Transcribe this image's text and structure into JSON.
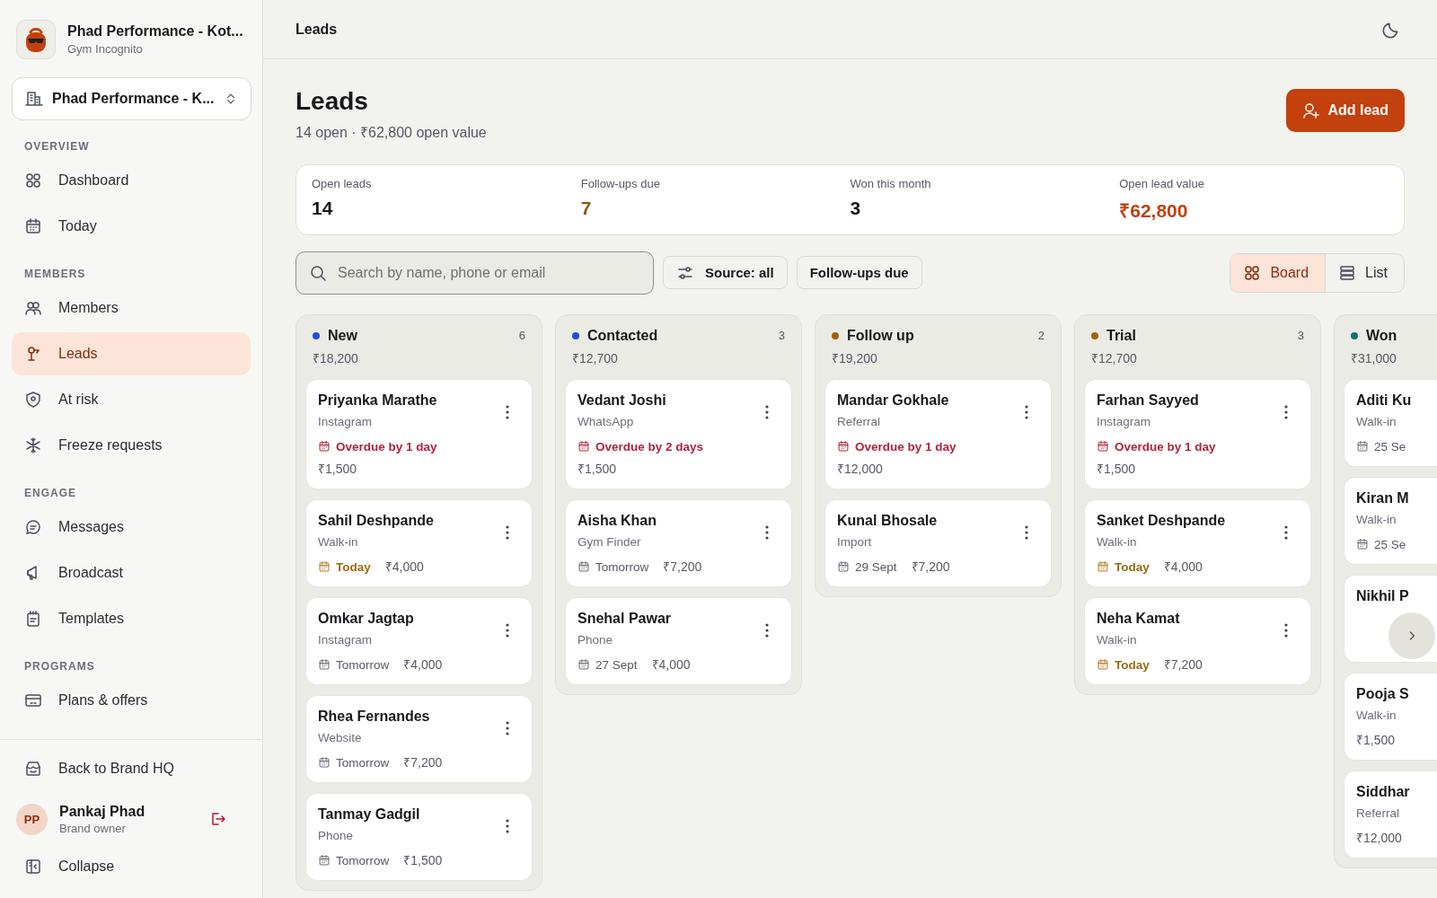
{
  "sidebar": {
    "brand": {
      "name": "Phad Performance - Kot...",
      "subtitle": "Gym Incognito"
    },
    "location": "Phad Performance - K...",
    "sections": [
      {
        "heading": "OVERVIEW",
        "items": [
          {
            "label": "Dashboard",
            "selected": false
          },
          {
            "label": "Today",
            "selected": false
          }
        ]
      },
      {
        "heading": "MEMBERS",
        "items": [
          {
            "label": "Members",
            "selected": false
          },
          {
            "label": "Leads",
            "selected": true
          },
          {
            "label": "At risk",
            "selected": false
          },
          {
            "label": "Freeze requests",
            "selected": false
          }
        ]
      },
      {
        "heading": "ENGAGE",
        "items": [
          {
            "label": "Messages",
            "selected": false
          },
          {
            "label": "Broadcast",
            "selected": false
          },
          {
            "label": "Templates",
            "selected": false
          }
        ]
      },
      {
        "heading": "PROGRAMS",
        "items": [
          {
            "label": "Plans & offers",
            "selected": false
          }
        ]
      }
    ],
    "back": "Back to Brand HQ",
    "user": {
      "initials": "PP",
      "name": "Pankaj Phad",
      "role": "Brand owner"
    },
    "collapse": "Collapse"
  },
  "topbar": {
    "title": "Leads"
  },
  "page": {
    "title": "Leads",
    "subtitle": "14 open · ₹62,800 open value",
    "add_button": "Add lead"
  },
  "stats": [
    {
      "label": "Open leads",
      "value": "14",
      "color": "#17181c"
    },
    {
      "label": "Follow-ups due",
      "value": "7",
      "color": "#8a5a0f"
    },
    {
      "label": "Won this month",
      "value": "3",
      "color": "#17181c"
    },
    {
      "label": "Open lead value",
      "value": "₹62,800",
      "color": "#c2410c"
    }
  ],
  "search": {
    "placeholder": "Search by name, phone or email"
  },
  "filters": [
    {
      "label": "Source: all",
      "kind": "source"
    },
    {
      "label": "Follow-ups due",
      "kind": "toggle"
    }
  ],
  "views": [
    {
      "label": "Board",
      "selected": true
    },
    {
      "label": "List",
      "selected": false
    }
  ],
  "columns": [
    {
      "name": "New",
      "color": "#1d4ed8",
      "count": "6",
      "total": "₹18,200",
      "cut": false,
      "cards": [
        {
          "name": "Priyanka Marathe",
          "source": "Instagram",
          "due": {
            "kind": "overdue",
            "text": "Overdue by 1 day"
          },
          "value": "₹1,500"
        },
        {
          "name": "Sahil Deshpande",
          "source": "Walk-in",
          "due": {
            "kind": "today",
            "text": "Today"
          },
          "value": "₹4,000"
        },
        {
          "name": "Omkar Jagtap",
          "source": "Instagram",
          "due": {
            "kind": "plain",
            "text": "Tomorrow"
          },
          "value": "₹4,000"
        },
        {
          "name": "Rhea Fernandes",
          "source": "Website",
          "due": {
            "kind": "plain",
            "text": "Tomorrow"
          },
          "value": "₹7,200"
        },
        {
          "name": "Tanmay Gadgil",
          "source": "Phone",
          "due": {
            "kind": "plain",
            "text": "Tomorrow"
          },
          "value": "₹1,500"
        }
      ]
    },
    {
      "name": "Contacted",
      "color": "#1d4ed8",
      "count": "3",
      "total": "₹12,700",
      "cut": false,
      "cards": [
        {
          "name": "Vedant Joshi",
          "source": "WhatsApp",
          "due": {
            "kind": "overdue",
            "text": "Overdue by 2 days"
          },
          "value": "₹1,500"
        },
        {
          "name": "Aisha Khan",
          "source": "Gym Finder",
          "due": {
            "kind": "plain",
            "text": "Tomorrow"
          },
          "value": "₹7,200"
        },
        {
          "name": "Snehal Pawar",
          "source": "Phone",
          "due": {
            "kind": "plain",
            "text": "27 Sept"
          },
          "value": "₹4,000"
        }
      ]
    },
    {
      "name": "Follow up",
      "color": "#a16207",
      "count": "2",
      "total": "₹19,200",
      "cut": false,
      "cards": [
        {
          "name": "Mandar Gokhale",
          "source": "Referral",
          "due": {
            "kind": "overdue",
            "text": "Overdue by 1 day"
          },
          "value": "₹12,000"
        },
        {
          "name": "Kunal Bhosale",
          "source": "Import",
          "due": {
            "kind": "plain",
            "text": "29 Sept"
          },
          "value": "₹7,200"
        }
      ]
    },
    {
      "name": "Trial",
      "color": "#a16207",
      "count": "3",
      "total": "₹12,700",
      "cut": false,
      "cards": [
        {
          "name": "Farhan Sayyed",
          "source": "Instagram",
          "due": {
            "kind": "overdue",
            "text": "Overdue by 1 day"
          },
          "value": "₹1,500"
        },
        {
          "name": "Sanket Deshpande",
          "source": "Walk-in",
          "due": {
            "kind": "today",
            "text": "Today"
          },
          "value": "₹4,000"
        },
        {
          "name": "Neha Kamat",
          "source": "Walk-in",
          "due": {
            "kind": "today",
            "text": "Today"
          },
          "value": "₹7,200"
        }
      ]
    },
    {
      "name": "Won",
      "color": "#0f766e",
      "total": "₹31,000",
      "cut": true,
      "cards": [
        {
          "name": "Aditi Ku",
          "source": "Walk-in",
          "due": {
            "kind": "plain",
            "text": "25 Se"
          }
        },
        {
          "name": "Kiran M",
          "source": "Walk-in",
          "due": {
            "kind": "plain",
            "text": "25 Se"
          }
        },
        {
          "name": "Nikhil P"
        },
        {
          "name": "Pooja S",
          "source": "Walk-in",
          "value": "₹1,500"
        },
        {
          "name": "Siddhar",
          "source": "Referral",
          "value": "₹12,000"
        }
      ]
    }
  ]
}
